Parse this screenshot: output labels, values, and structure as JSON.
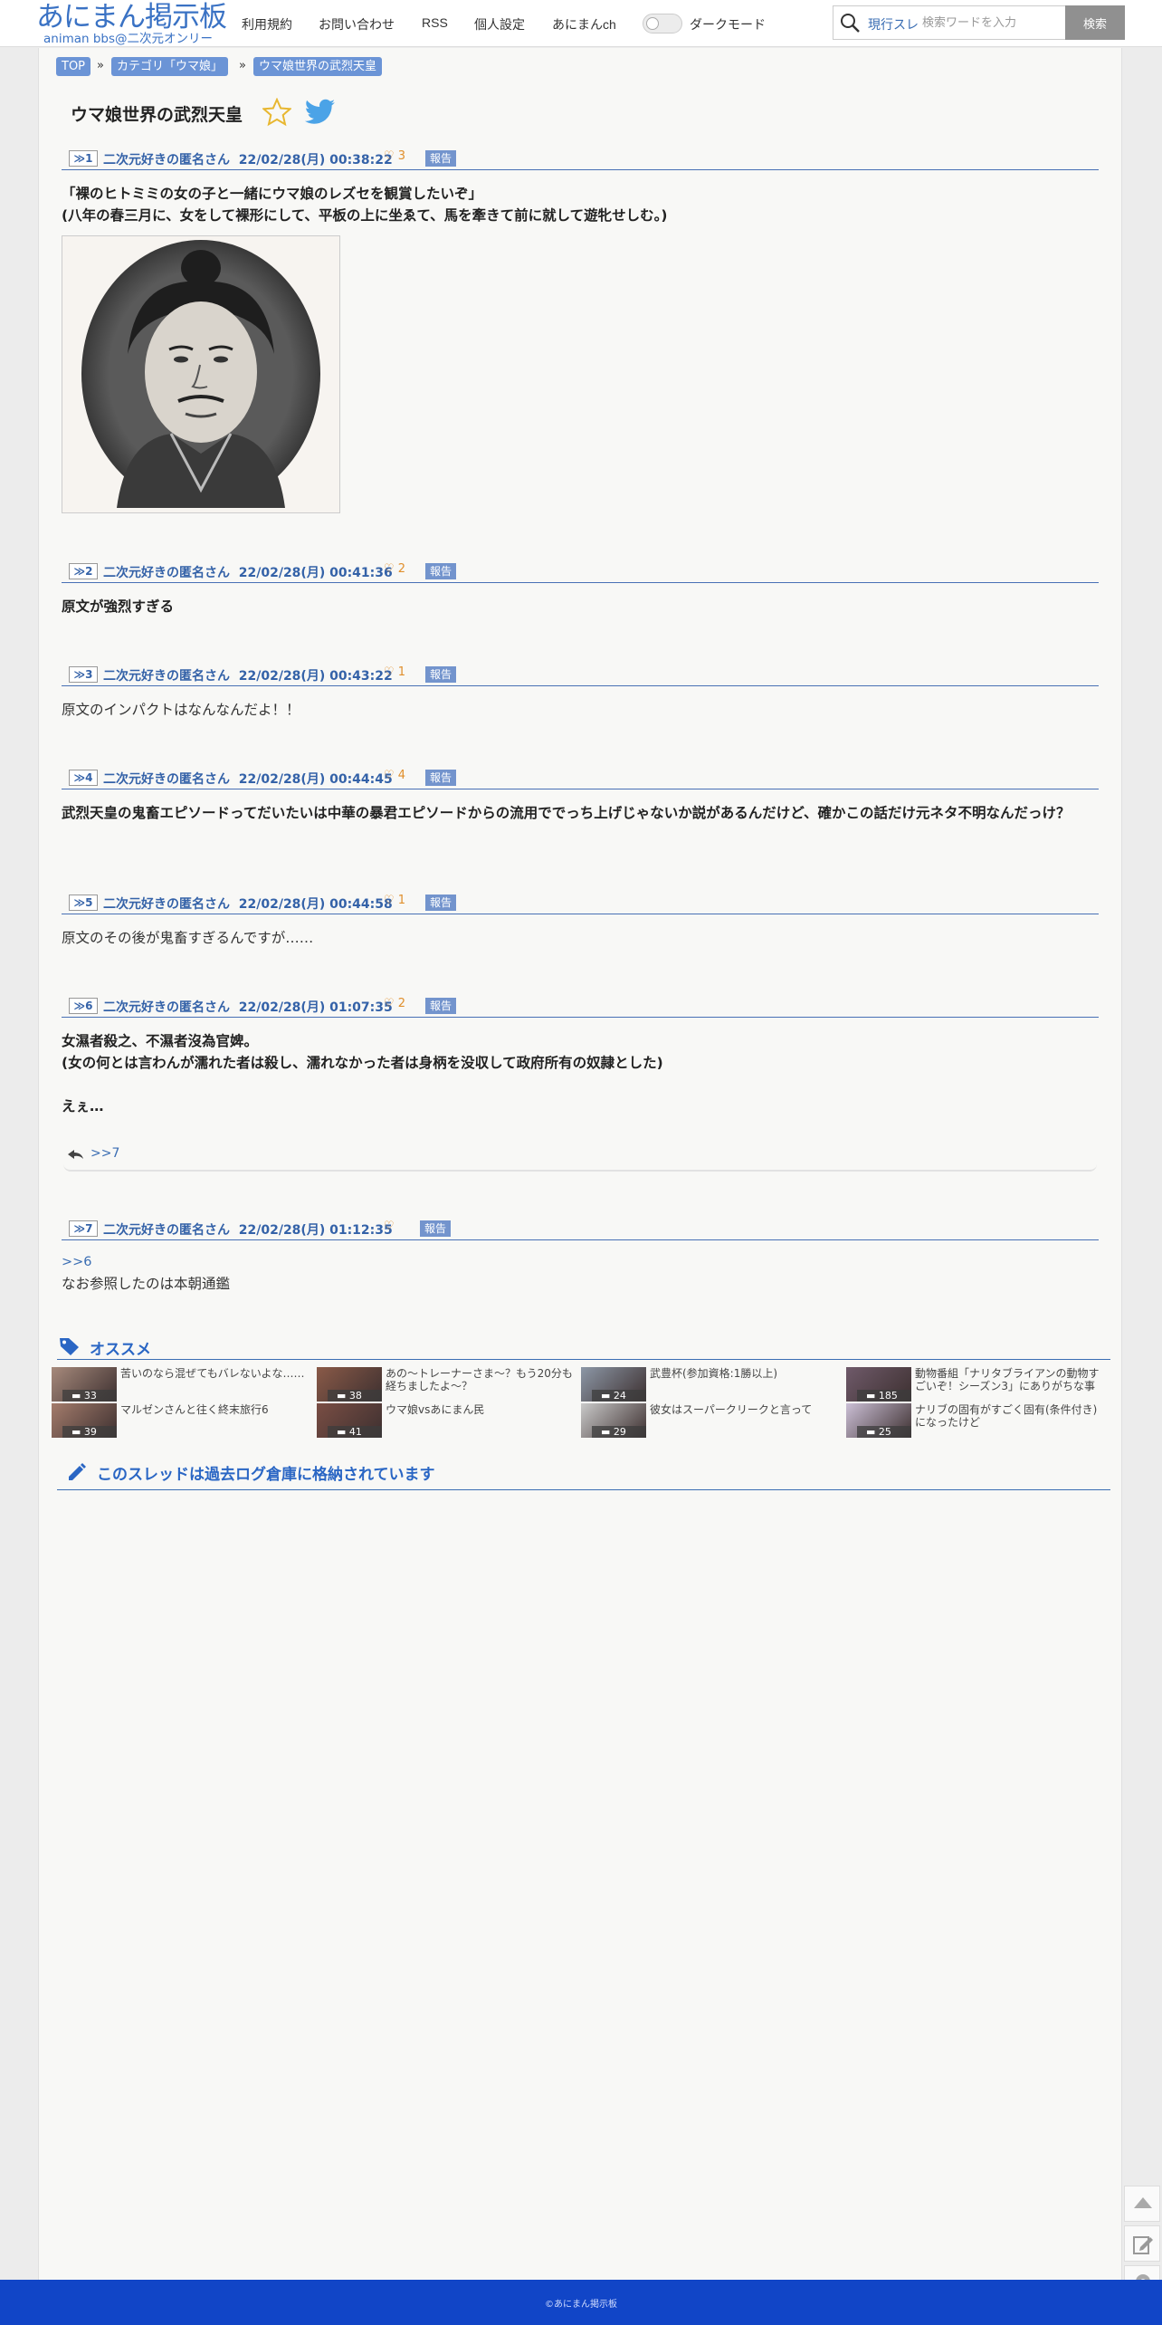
{
  "header": {
    "logo_main": "あにまん掲示板",
    "logo_sub": "animan bbs@二次元オンリー",
    "nav": [
      "利用規約",
      "お問い合わせ",
      "RSS",
      "個人設定",
      "あにまんch"
    ],
    "dark_mode_label": "ダークモード",
    "search_scope": "現行スレ",
    "search_placeholder": "検索ワードを入力",
    "search_button": "検索"
  },
  "breadcrumb": [
    "TOP",
    "カテゴリ「ウマ娘」",
    "ウマ娘世界の武烈天皇"
  ],
  "breadcrumb_sep": "»",
  "thread_title": "ウマ娘世界の武烈天皇",
  "report_label": "報告",
  "like_icon": "♡",
  "posts": [
    {
      "num": "≫1",
      "name": "二次元好きの匿名さん",
      "date": "22/02/28(月) 00:38:22",
      "likes": "3",
      "body": "「裸のヒトミミの女の子と一緒にウマ娘のレズセを観賞したいぞ￼」\n(八年の春三月に、女をして裸形にして、平板の上に坐ゑて、馬を牽きて前に就して遊牝せしむ。)"
    },
    {
      "num": "≫2",
      "name": "二次元好きの匿名さん",
      "date": "22/02/28(月) 00:41:36",
      "likes": "2",
      "body": "原文が強烈すぎる"
    },
    {
      "num": "≫3",
      "name": "二次元好きの匿名さん",
      "date": "22/02/28(月) 00:43:22",
      "likes": "1",
      "body": "原文のインパクトはなんなんだよ！！"
    },
    {
      "num": "≫4",
      "name": "二次元好きの匿名さん",
      "date": "22/02/28(月) 00:44:45",
      "likes": "4",
      "body": "武烈天皇の鬼畜エピソードってだいたいは中華の暴君エピソードからの流用ででっち上げじゃないか説があるんだけど、確かこの話だけ元ネタ不明なんだっけ？"
    },
    {
      "num": "≫5",
      "name": "二次元好きの匿名さん",
      "date": "22/02/28(月) 00:44:58",
      "likes": "1",
      "body": "原文のその後が鬼畜すぎるんですが……"
    },
    {
      "num": "≫6",
      "name": "二次元好きの匿名さん",
      "date": "22/02/28(月) 01:07:35",
      "likes": "2",
      "body": "女濕者殺之、不濕者沒為官婢。\n(女の何とは言わんが濡れた者は殺し、濡れなかった者は身柄を没収して政府所有の奴隷とした)\n\nえぇ…"
    },
    {
      "num": "≫7",
      "name": "二次元好きの匿名さん",
      "date": "22/02/28(月) 01:12:35",
      "likes": "",
      "body": "なお参照したのは本朝通鑑"
    }
  ],
  "reply_link": ">>7",
  "post7_anchor": ">>6",
  "recommend_title": "オススメ",
  "recommend": [
    {
      "title": "苦いのなら混ぜてもバレないよな……",
      "count": "33",
      "color": "#a78a7c"
    },
    {
      "title": "あの〜トレーナーさま〜？もう20分も経ちましたよ〜？",
      "count": "38",
      "color": "#8a5a48"
    },
    {
      "title": "武豊杯(参加資格:1勝以上)",
      "count": "24",
      "color": "#8c97a6"
    },
    {
      "title": "動物番組「ナリタブライアンの動物すごいぞ！シーズン3」にありがちな事",
      "count": "185",
      "color": "#6f5a6a"
    },
    {
      "title": "マルゼンさんと往く終末旅行6",
      "count": "39",
      "color": "#a47c6c"
    },
    {
      "title": "ウマ娘vsあにまん民",
      "count": "41",
      "color": "#7a4e44"
    },
    {
      "title": "彼女はスーパークリークと言って",
      "count": "29",
      "color": "#c9c9c9"
    },
    {
      "title": "ナリブの固有がすごく固有(条件付き)になったけど",
      "count": "25",
      "color": "#cbbfd6"
    }
  ],
  "archive_notice": "このスレッドは過去ログ倉庫に格納されています",
  "footer": "©あにまん掲示板",
  "colors": {
    "brand": "#3a72c4",
    "footer": "#1145c7",
    "like": "#e08f2c",
    "link": "#3462a8"
  }
}
